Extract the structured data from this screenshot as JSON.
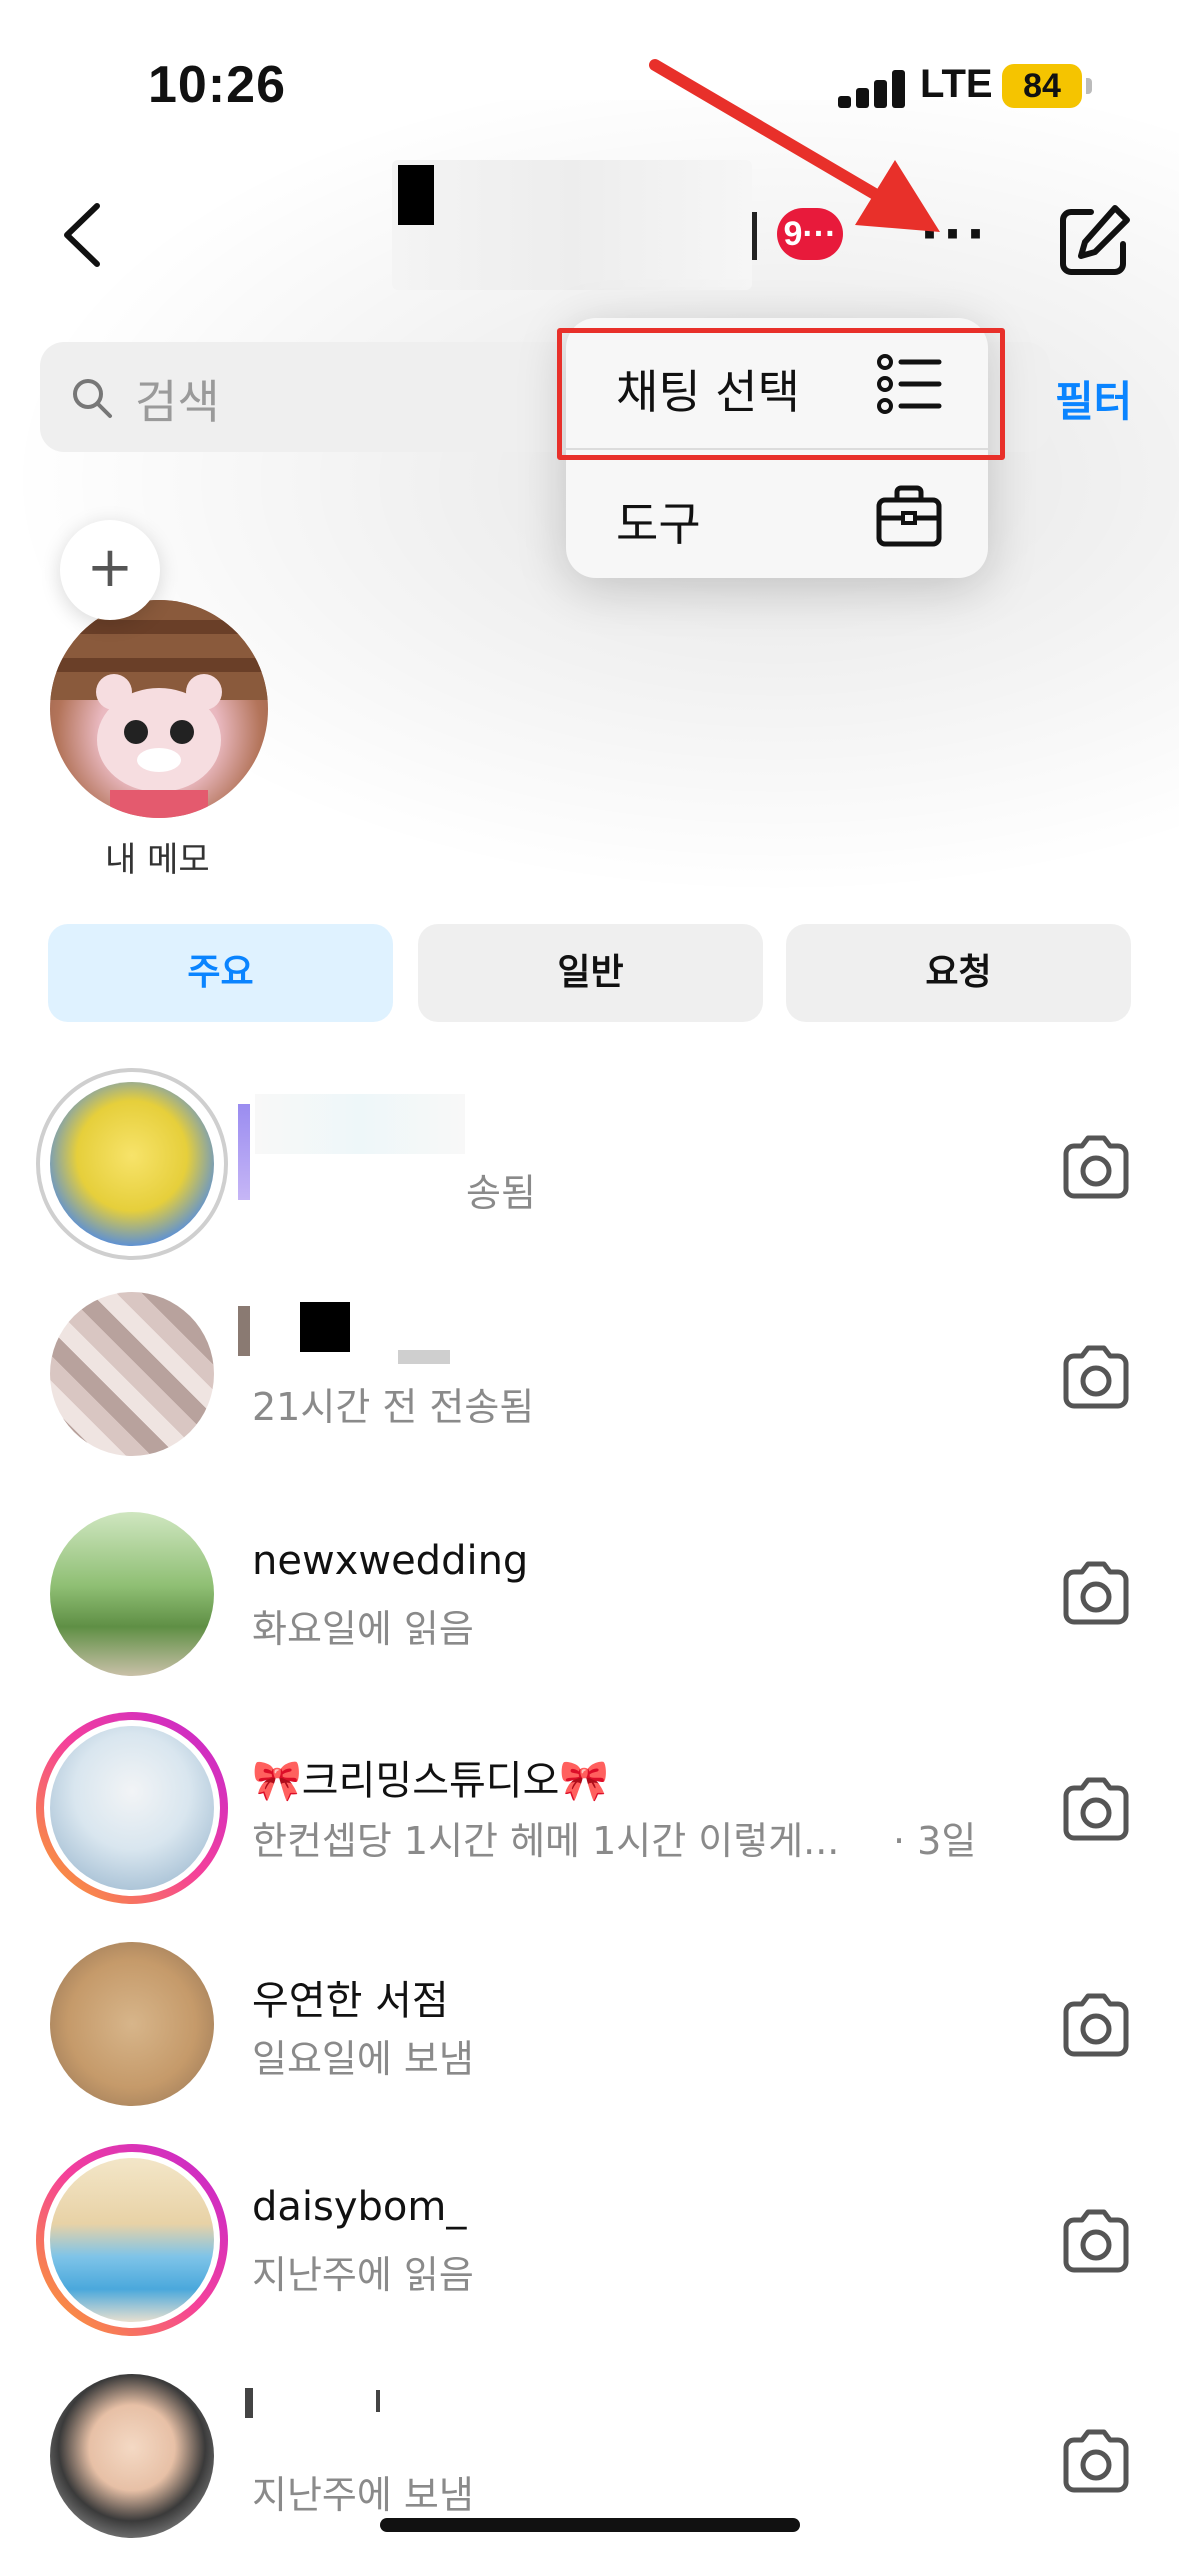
{
  "status_bar": {
    "time": "10:26",
    "network": "LTE",
    "battery": "84"
  },
  "header": {
    "notification_count": "9···",
    "more_label": "···"
  },
  "search": {
    "placeholder": "검색",
    "filter_label": "필터"
  },
  "menu": {
    "items": [
      {
        "label": "채팅 선택",
        "icon": "list-icon"
      },
      {
        "label": "도구",
        "icon": "toolbox-icon"
      }
    ]
  },
  "note": {
    "caption": "내 메모",
    "add": "+"
  },
  "tabs": [
    {
      "label": "주요",
      "active": true
    },
    {
      "label": "일반",
      "active": false
    },
    {
      "label": "요청",
      "active": false
    }
  ],
  "threads": [
    {
      "name": "",
      "sub": "송됨",
      "meta": ""
    },
    {
      "name": "",
      "sub": "21시간 전 전송됨",
      "meta": ""
    },
    {
      "name": "newxwedding",
      "sub": "화요일에 읽음",
      "meta": ""
    },
    {
      "name": "🎀크리밍스튜디오🎀",
      "sub": "한컨셉당 1시간 헤메 1시간 이렇게...",
      "meta": "· 3일"
    },
    {
      "name": "우연한 서점",
      "sub": "일요일에 보냄",
      "meta": ""
    },
    {
      "name": "daisybom_",
      "sub": "지난주에 읽음",
      "meta": ""
    },
    {
      "name": "",
      "sub": "지난주에 보냄",
      "meta": ""
    }
  ],
  "colors": {
    "accent": "#0a84ff",
    "badge": "#e81a3b",
    "annotation": "#e8302a"
  }
}
